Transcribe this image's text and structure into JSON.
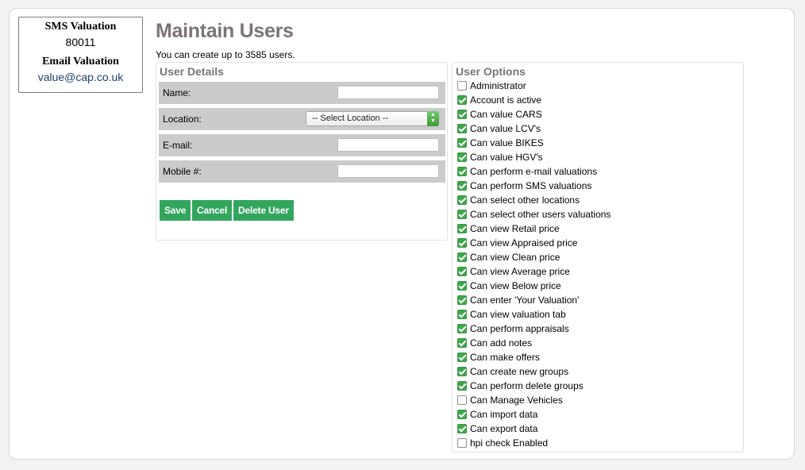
{
  "valuation": {
    "sms_title": "SMS Valuation",
    "sms_value": "80011",
    "email_title": "Email Valuation",
    "email_value": "value@cap.co.uk"
  },
  "page": {
    "title": "Maintain Users",
    "subtitle": "You can create up to 3585 users."
  },
  "user_details": {
    "heading": "User Details",
    "name_label": "Name:",
    "name_value": "",
    "location_label": "Location:",
    "location_selected": "-- Select Location --",
    "email_label": "E-mail:",
    "email_value": "",
    "mobile_label": "Mobile #:",
    "mobile_value": ""
  },
  "buttons": {
    "save": "Save",
    "cancel": "Cancel",
    "delete": "Delete User"
  },
  "user_options": {
    "heading": "User Options",
    "items": [
      {
        "label": "Administrator",
        "checked": false
      },
      {
        "label": "Account is active",
        "checked": true
      },
      {
        "label": "Can value CARS",
        "checked": true
      },
      {
        "label": "Can value LCV's",
        "checked": true
      },
      {
        "label": "Can value BIKES",
        "checked": true
      },
      {
        "label": "Can value HGV's",
        "checked": true
      },
      {
        "label": "Can perform e-mail valuations",
        "checked": true
      },
      {
        "label": "Can perform SMS valuations",
        "checked": true
      },
      {
        "label": "Can select other locations",
        "checked": true
      },
      {
        "label": "Can select other users valuations",
        "checked": true
      },
      {
        "label": "Can view Retail price",
        "checked": true
      },
      {
        "label": "Can view Appraised price",
        "checked": true
      },
      {
        "label": "Can view Clean price",
        "checked": true
      },
      {
        "label": "Can view Average price",
        "checked": true
      },
      {
        "label": "Can view Below price",
        "checked": true
      },
      {
        "label": "Can enter 'Your Valuation'",
        "checked": true
      },
      {
        "label": "Can view valuation tab",
        "checked": true
      },
      {
        "label": "Can perform appraisals",
        "checked": true
      },
      {
        "label": "Can add notes",
        "checked": true
      },
      {
        "label": "Can make offers",
        "checked": true
      },
      {
        "label": "Can create new groups",
        "checked": true
      },
      {
        "label": "Can perform delete groups",
        "checked": true
      },
      {
        "label": "Can Manage Vehicles",
        "checked": false
      },
      {
        "label": "Can import data",
        "checked": true
      },
      {
        "label": "Can export data",
        "checked": true
      },
      {
        "label": "hpi check Enabled",
        "checked": false
      }
    ]
  },
  "colors": {
    "button": "#33a65e",
    "heading": "#7c7470",
    "row_bg": "#cbcbcb",
    "checkbox_on": "#3ea74a"
  }
}
